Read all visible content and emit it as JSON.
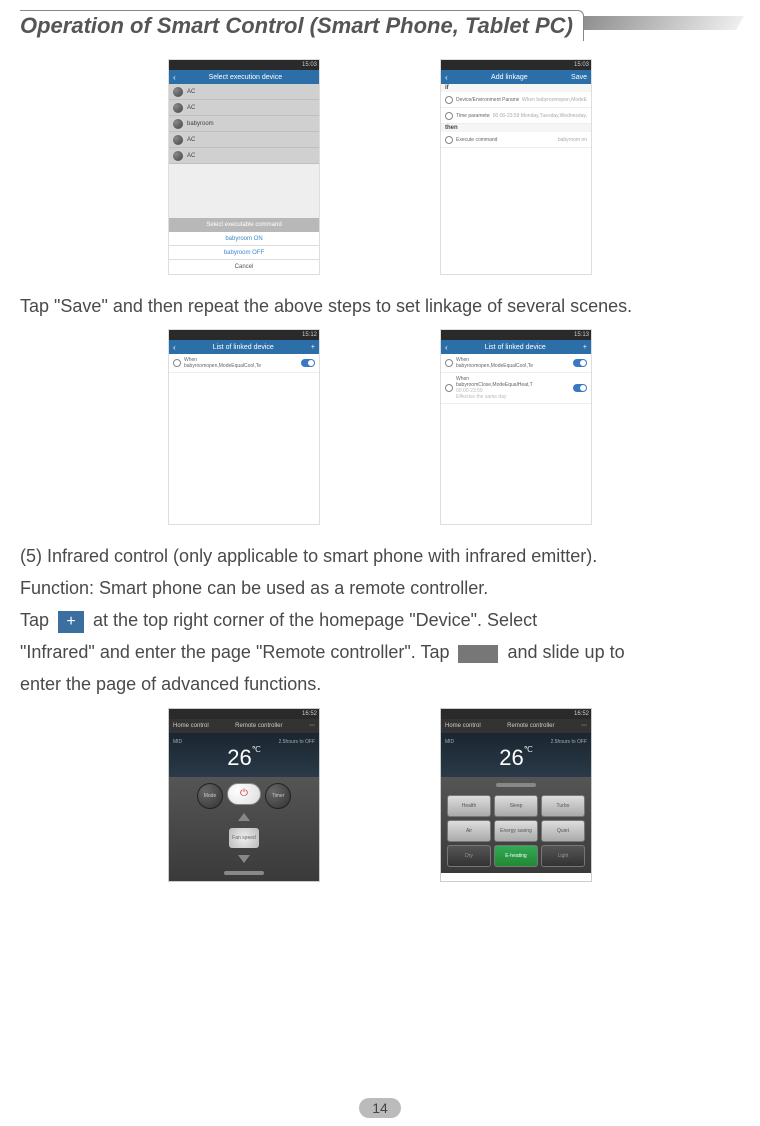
{
  "heading": "Operation of Smart Control (Smart Phone, Tablet PC)",
  "page_number": "14",
  "text": {
    "save_line": "Tap \"Save\" and then repeat the above steps to set linkage of several scenes.",
    "ir_line1": "(5) Infrared control (only applicable to smart phone with infrared emitter).",
    "ir_line2": "Function: Smart phone can be used as a remote controller.",
    "tap1a": "Tap ",
    "tap1b": " at the top right corner of the homepage \"Device\". Select",
    "tap2a": "\"Infrared\" and enter the page \"Remote controller\". Tap ",
    "tap2b": " and slide up to",
    "tap3": "enter the page of advanced functions."
  },
  "screens": {
    "s1": {
      "time": "15:03",
      "title": "Select execution device",
      "devices": [
        "AC",
        "AC",
        "babyroom",
        "AC",
        "AC"
      ],
      "sheet_title": "Select executable command",
      "sheet_items": [
        "babyroom ON",
        "babyroom OFF"
      ],
      "sheet_cancel": "Cancel"
    },
    "s2": {
      "time": "15:03",
      "title": "Add linkage",
      "save": "Save",
      "if_label": "if",
      "then_label": "then",
      "row1": "Device/Environment Parameter",
      "row1v": "When babyroomopen,ModeE",
      "row2": "Time parameter",
      "row2v": "00:00-23:59 Monday,Tuesday,Wednesday,",
      "row3": "Execute command",
      "row3v": "babyroom on"
    },
    "s3": {
      "time": "15:12",
      "title": "List of linked device",
      "plus": "+",
      "item1_l1": "When",
      "item1_l2": "babyroomopen,ModeEqualCool,Te"
    },
    "s4": {
      "time": "15:13",
      "title": "List of linked device",
      "plus": "+",
      "item1_l1": "When",
      "item1_l2": "babyroomopen,ModeEqualCool,Te",
      "item2_l1": "When",
      "item2_l2": "babyroomClose,ModeEqualHeat,T",
      "item2_l3": "00:00-23:59",
      "item2_l4": "Effective the same day"
    },
    "s5": {
      "time": "16:52",
      "header_left": "Home control",
      "header_title": "Remote controller",
      "mid": "MID",
      "temp": "26",
      "unit": "℃",
      "off": "2.5hours to OFF",
      "mode": "Mode",
      "timer": "Timer",
      "fan": "Fan speed"
    },
    "s6": {
      "time": "16:52",
      "header_left": "Home control",
      "header_title": "Remote controller",
      "mid": "MID",
      "temp": "26",
      "unit": "℃",
      "off": "2.5hours to OFF",
      "btns": [
        "Health",
        "Sleep",
        "Turbo",
        "Air",
        "Energy saving",
        "Quiet",
        "Dry",
        "E-heating",
        "Light"
      ]
    }
  }
}
